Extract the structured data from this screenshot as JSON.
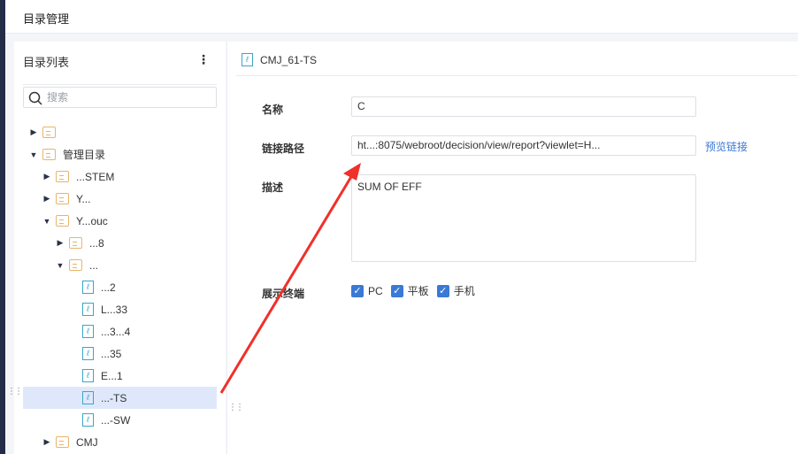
{
  "header": {
    "title": "目录管理"
  },
  "sidebar": {
    "title": "目录列表",
    "more": "⋮",
    "search_placeholder": "搜索",
    "tree": [
      {
        "label": "",
        "level": 0,
        "type": "folder",
        "expanded": false
      },
      {
        "label": "管理目录",
        "level": 0,
        "type": "folder",
        "expanded": true
      },
      {
        "label": "...STEM",
        "level": 1,
        "type": "folder",
        "expanded": false
      },
      {
        "label": "Y...",
        "level": 1,
        "type": "folder",
        "expanded": false
      },
      {
        "label": "Y...ouc",
        "level": 1,
        "type": "folder",
        "expanded": true
      },
      {
        "label": "...8",
        "level": 2,
        "type": "folder",
        "expanded": false
      },
      {
        "label": "...",
        "level": 2,
        "type": "folder",
        "expanded": true
      },
      {
        "label": "...2",
        "level": 3,
        "type": "report"
      },
      {
        "label": "L...33",
        "level": 3,
        "type": "report"
      },
      {
        "label": "...3...4",
        "level": 3,
        "type": "report"
      },
      {
        "label": "...35",
        "level": 3,
        "type": "report"
      },
      {
        "label": "E...1",
        "level": 3,
        "type": "report"
      },
      {
        "label": "...-TS",
        "level": 3,
        "type": "report",
        "selected": true
      },
      {
        "label": "...-SW",
        "level": 3,
        "type": "report"
      },
      {
        "label": "CMJ",
        "level": 1,
        "type": "folder",
        "expanded": false
      }
    ]
  },
  "detail": {
    "title": "CMJ_61-TS",
    "name_label": "名称",
    "name_value": "C",
    "path_label": "链接路径",
    "path_value": "ht...:8075/webroot/decision/view/report?viewlet=H...",
    "preview_link": "预览链接",
    "desc_label": "描述",
    "desc_value": "SUM OF EFF",
    "terminal_label": "展示终端",
    "terminals": [
      {
        "label": "PC",
        "checked": true
      },
      {
        "label": "平板",
        "checked": true
      },
      {
        "label": "手机",
        "checked": true
      }
    ]
  },
  "colors": {
    "accent": "#3a79d6",
    "annotation_arrow": "#f0302a"
  }
}
